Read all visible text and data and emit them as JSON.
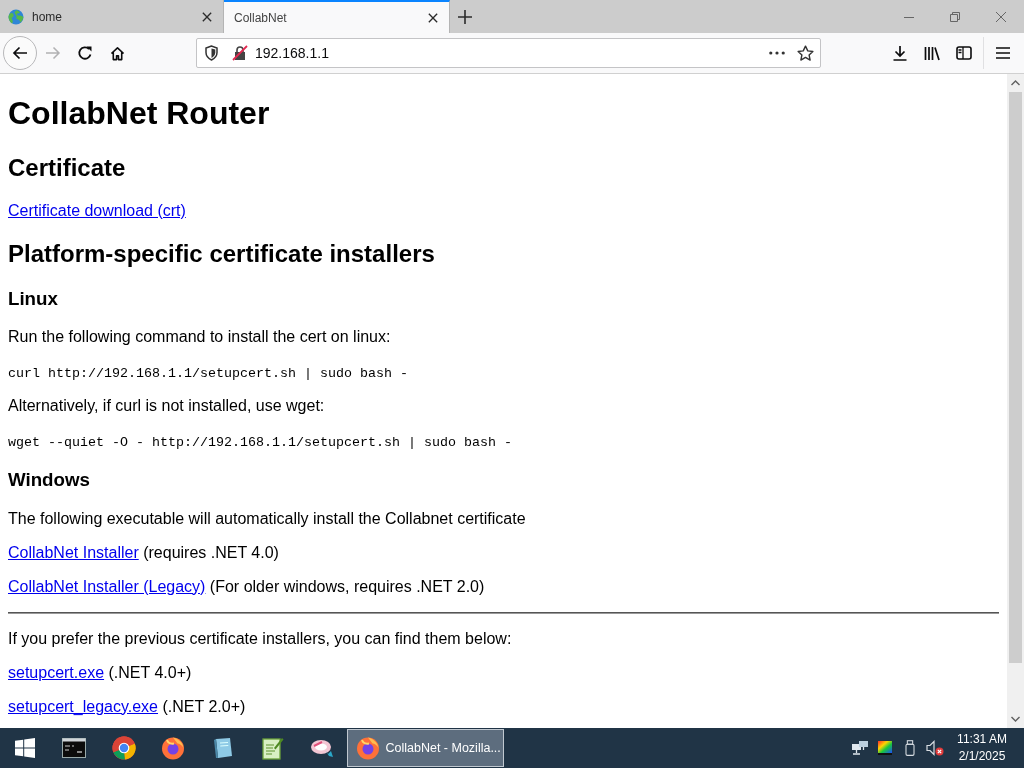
{
  "browser": {
    "tabs": [
      {
        "title": "home",
        "favicon": true,
        "selected": false
      },
      {
        "title": "CollabNet",
        "favicon": false,
        "selected": true
      }
    ],
    "nav_buttons": [
      {
        "kind": "back",
        "disabled": false
      },
      {
        "kind": "forward",
        "disabled": true
      },
      {
        "kind": "reload",
        "disabled": false
      },
      {
        "kind": "home",
        "disabled": false
      }
    ],
    "address_bar": {
      "url": "192.168.1.1"
    }
  },
  "page": {
    "blocks": [
      {
        "kind": "h1",
        "text": "CollabNet Router"
      },
      {
        "kind": "h2",
        "text": "Certificate"
      },
      {
        "kind": "paragraph",
        "parts": [
          {
            "kind": "link",
            "text": "Certificate download (crt)"
          }
        ]
      },
      {
        "kind": "h2",
        "text": "Platform-specific certificate installers"
      },
      {
        "kind": "h3",
        "text": "Linux"
      },
      {
        "kind": "paragraph",
        "parts": [
          {
            "kind": "text",
            "text": "Run the following command to install the cert on linux:"
          }
        ]
      },
      {
        "kind": "code",
        "text": "curl http://192.168.1.1/setupcert.sh | sudo bash -"
      },
      {
        "kind": "paragraph",
        "parts": [
          {
            "kind": "text",
            "text": "Alternatively, if curl is not installed, use wget:"
          }
        ]
      },
      {
        "kind": "code",
        "text": "wget --quiet -O - http://192.168.1.1/setupcert.sh | sudo bash -"
      },
      {
        "kind": "h3",
        "text": "Windows"
      },
      {
        "kind": "paragraph",
        "parts": [
          {
            "kind": "text",
            "text": "The following executable will automatically install the Collabnet certificate"
          }
        ]
      },
      {
        "kind": "paragraph",
        "parts": [
          {
            "kind": "link",
            "text": "CollabNet Installer"
          },
          {
            "kind": "text",
            "text": " (requires .NET 4.0)"
          }
        ]
      },
      {
        "kind": "paragraph",
        "parts": [
          {
            "kind": "link",
            "text": "CollabNet Installer (Legacy)"
          },
          {
            "kind": "text",
            "text": " (For older windows, requires .NET 2.0)"
          }
        ]
      },
      {
        "kind": "rule"
      },
      {
        "kind": "paragraph",
        "parts": [
          {
            "kind": "text",
            "text": "If you prefer the previous certificate installers, you can find them below:"
          }
        ]
      },
      {
        "kind": "paragraph",
        "parts": [
          {
            "kind": "link",
            "text": "setupcert.exe"
          },
          {
            "kind": "text",
            "text": " (.NET 4.0+)"
          }
        ]
      },
      {
        "kind": "paragraph",
        "parts": [
          {
            "kind": "link",
            "text": "setupcert_legacy.exe"
          },
          {
            "kind": "text",
            "text": " (.NET 2.0+)"
          }
        ]
      }
    ]
  },
  "taskbar": {
    "windows": [
      {
        "title": "CollabNet - Mozilla...",
        "selected": true
      }
    ],
    "clock": {
      "time": "11:31 AM",
      "date": "2/1/2025"
    }
  }
}
